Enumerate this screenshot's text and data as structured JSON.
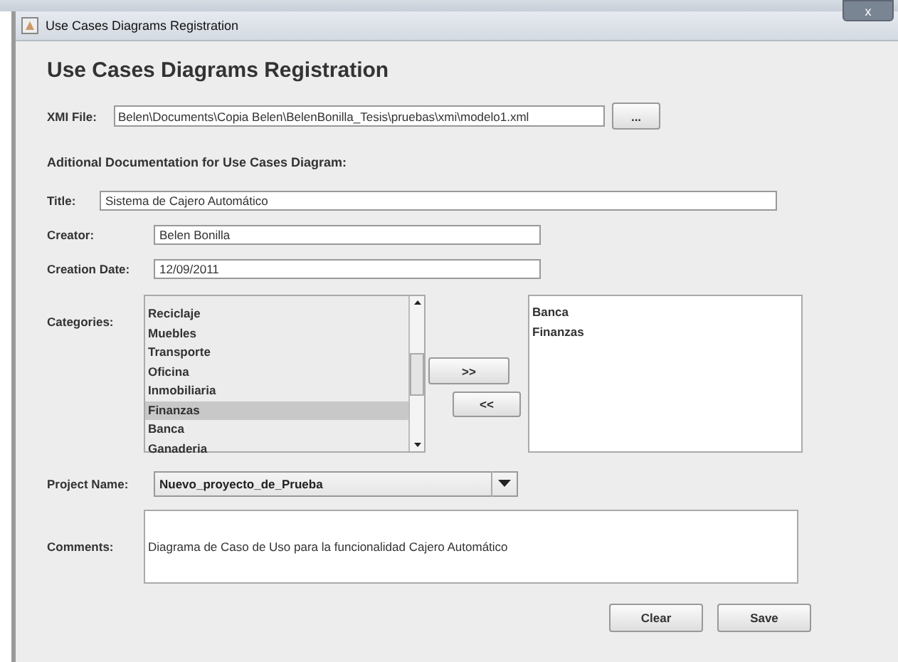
{
  "window": {
    "title": "Use Cases Diagrams Registration",
    "close": "x"
  },
  "heading": "Use Cases Diagrams Registration",
  "xmi_file": {
    "label": "XMI File:",
    "value": "Belen\\Documents\\Copia Belen\\BelenBonilla_Tesis\\pruebas\\xmi\\modelo1.xml",
    "browse": "..."
  },
  "subheading": "Aditional Documentation for Use Cases Diagram:",
  "fields": [
    {
      "label": "Title:",
      "value": "Sistema de Cajero Automático"
    },
    {
      "label": "Creator:",
      "value": "Belen Bonilla"
    },
    {
      "label": "Creation Date:",
      "value": "12/09/2011"
    }
  ],
  "categories": {
    "label": "Categories:",
    "available": [
      {
        "label": "Reciclaje",
        "selected": false
      },
      {
        "label": "Muebles",
        "selected": false
      },
      {
        "label": "Transporte",
        "selected": false
      },
      {
        "label": "Oficina",
        "selected": false
      },
      {
        "label": "Inmobiliaria",
        "selected": false
      },
      {
        "label": "Finanzas",
        "selected": true
      },
      {
        "label": "Banca",
        "selected": false
      },
      {
        "label": "Ganaderia",
        "selected": false
      }
    ],
    "add": ">>",
    "remove": "<<",
    "chosen": [
      {
        "label": "Banca",
        "selected": false
      },
      {
        "label": "Finanzas",
        "selected": false
      }
    ]
  },
  "project": {
    "label": "Project Name:",
    "value": "Nuevo_proyecto_de_Prueba"
  },
  "comments": {
    "label": "Comments:",
    "value": "Diagrama de Caso de Uso para la funcionalidad Cajero Automático"
  },
  "buttons": [
    "Clear",
    "Save"
  ]
}
